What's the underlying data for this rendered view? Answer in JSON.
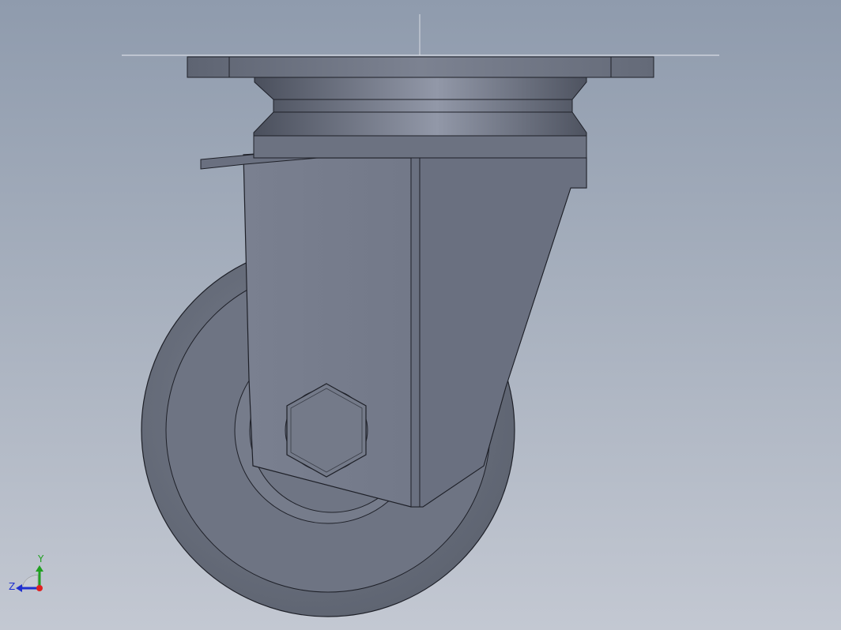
{
  "viewport": {
    "model": "swivel-caster-with-brake"
  },
  "triad": {
    "y_label": "Y",
    "z_label": "Z",
    "x_color": "#e02020",
    "y_color": "#20a020",
    "z_color": "#2030d0"
  },
  "colors": {
    "background_top": "#8f9bad",
    "background_bottom": "#c3c8d2",
    "model_face": "#737988",
    "model_edge": "#1e2028"
  }
}
